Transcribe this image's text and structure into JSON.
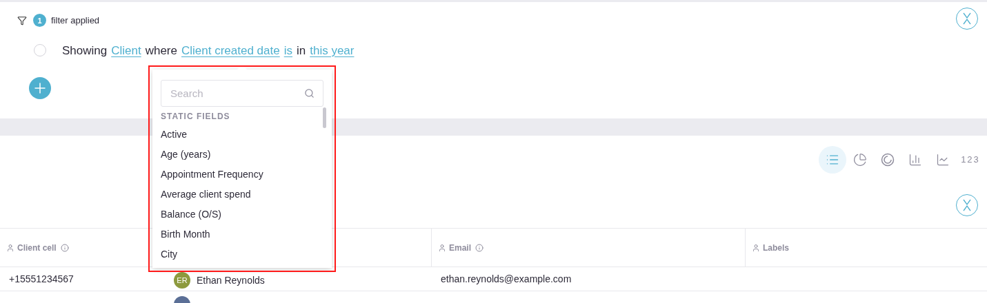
{
  "filter_bar": {
    "count": "1",
    "label": "filter applied"
  },
  "rule": {
    "selected": false,
    "parts": [
      {
        "kind": "text",
        "text": "Showing"
      },
      {
        "kind": "link",
        "text": "Client"
      },
      {
        "kind": "text",
        "text": "where"
      },
      {
        "kind": "link",
        "text": "Client created date"
      },
      {
        "kind": "link",
        "text": "is"
      },
      {
        "kind": "text",
        "text": "in"
      },
      {
        "kind": "link",
        "text": "this year"
      }
    ]
  },
  "field_dropdown": {
    "search": {
      "placeholder": "Search"
    },
    "section": "STATIC FIELDS",
    "items": [
      "Active",
      "Age (years)",
      "Appointment Frequency",
      "Average client spend",
      "Balance (O/S)",
      "Birth Month",
      "City"
    ]
  },
  "view_types": [
    {
      "kind": "table",
      "selected": true
    },
    {
      "kind": "pie",
      "selected": false
    },
    {
      "kind": "donut",
      "selected": false
    },
    {
      "kind": "bar",
      "selected": false
    },
    {
      "kind": "line",
      "selected": false
    },
    {
      "kind": "number",
      "label": "123",
      "selected": false
    }
  ],
  "table": {
    "columns": [
      {
        "label": "Client cell",
        "info": true
      },
      {},
      {
        "label": "Email",
        "info": true
      },
      {
        "label": "Labels",
        "info": false
      }
    ],
    "rows": [
      {
        "phone": "+15551234567",
        "avatar": {
          "initials": "ER",
          "color": "#8d9a3e"
        },
        "name": "Ethan Reynolds",
        "email": "ethan.reynolds@example.com"
      },
      {
        "avatar": {
          "color": "#5b6f96"
        }
      }
    ]
  }
}
